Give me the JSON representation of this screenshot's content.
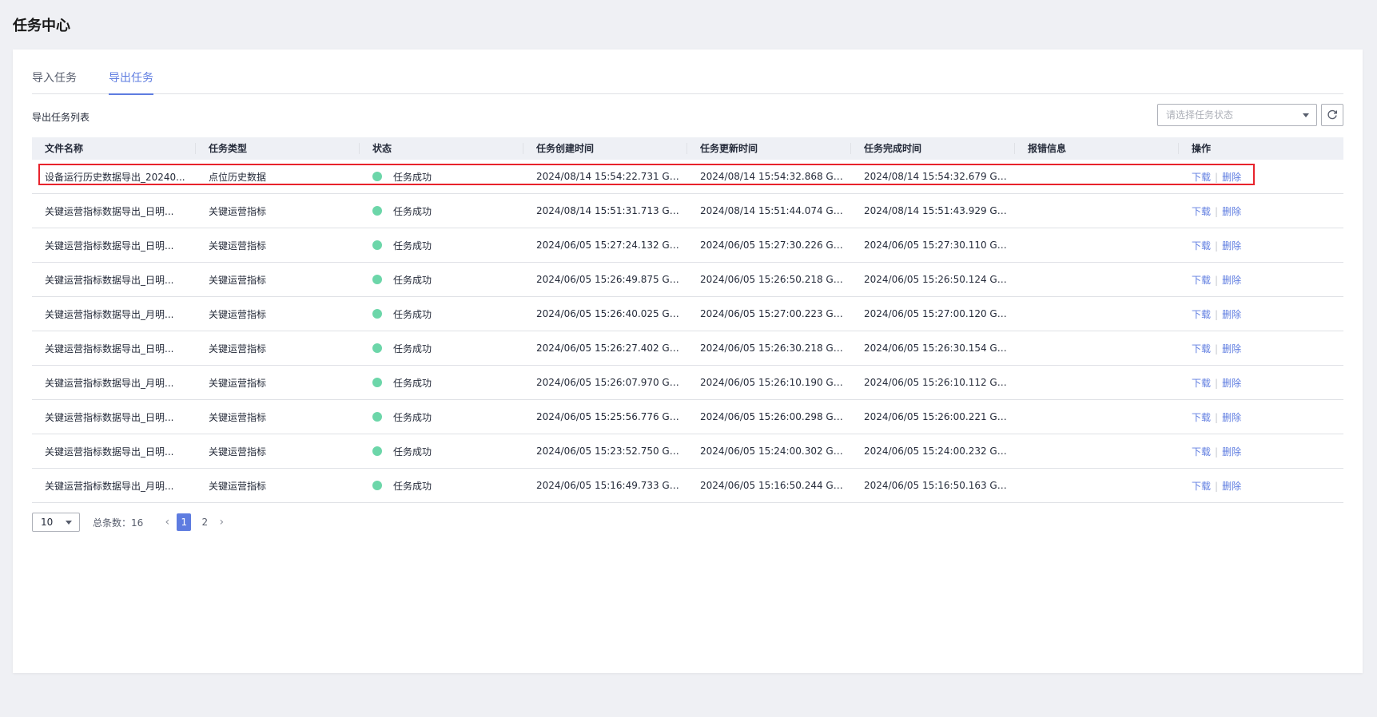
{
  "page_title": "任务中心",
  "tabs": [
    {
      "label": "导入任务",
      "active": false
    },
    {
      "label": "导出任务",
      "active": true
    }
  ],
  "list_title": "导出任务列表",
  "status_filter": {
    "placeholder": "请选择任务状态"
  },
  "refresh_icon": "refresh-icon",
  "columns": [
    "文件名称",
    "任务类型",
    "状态",
    "任务创建时间",
    "任务更新时间",
    "任务完成时间",
    "报错信息",
    "操作"
  ],
  "rows": [
    {
      "name": "设备运行历史数据导出_20240...",
      "type": "点位历史数据",
      "status": "任务成功",
      "created": "2024/08/14 15:54:22.731 GM...",
      "updated": "2024/08/14 15:54:32.868 GM...",
      "finished": "2024/08/14 15:54:32.679 GM...",
      "error": "",
      "download": "下载",
      "delete": "删除"
    },
    {
      "name": "关键运营指标数据导出_日明...",
      "type": "关键运营指标",
      "status": "任务成功",
      "created": "2024/08/14 15:51:31.713 GM...",
      "updated": "2024/08/14 15:51:44.074 GM...",
      "finished": "2024/08/14 15:51:43.929 GM...",
      "error": "",
      "download": "下载",
      "delete": "删除"
    },
    {
      "name": "关键运营指标数据导出_日明...",
      "type": "关键运营指标",
      "status": "任务成功",
      "created": "2024/06/05 15:27:24.132 GM...",
      "updated": "2024/06/05 15:27:30.226 GM...",
      "finished": "2024/06/05 15:27:30.110 GM...",
      "error": "",
      "download": "下载",
      "delete": "删除"
    },
    {
      "name": "关键运营指标数据导出_日明...",
      "type": "关键运营指标",
      "status": "任务成功",
      "created": "2024/06/05 15:26:49.875 GM...",
      "updated": "2024/06/05 15:26:50.218 GM...",
      "finished": "2024/06/05 15:26:50.124 GM...",
      "error": "",
      "download": "下载",
      "delete": "删除"
    },
    {
      "name": "关键运营指标数据导出_月明...",
      "type": "关键运营指标",
      "status": "任务成功",
      "created": "2024/06/05 15:26:40.025 GM...",
      "updated": "2024/06/05 15:27:00.223 GM...",
      "finished": "2024/06/05 15:27:00.120 GM...",
      "error": "",
      "download": "下载",
      "delete": "删除"
    },
    {
      "name": "关键运营指标数据导出_日明...",
      "type": "关键运营指标",
      "status": "任务成功",
      "created": "2024/06/05 15:26:27.402 GM...",
      "updated": "2024/06/05 15:26:30.218 GM...",
      "finished": "2024/06/05 15:26:30.154 GM...",
      "error": "",
      "download": "下载",
      "delete": "删除"
    },
    {
      "name": "关键运营指标数据导出_月明...",
      "type": "关键运营指标",
      "status": "任务成功",
      "created": "2024/06/05 15:26:07.970 GM...",
      "updated": "2024/06/05 15:26:10.190 GM...",
      "finished": "2024/06/05 15:26:10.112 GM...",
      "error": "",
      "download": "下载",
      "delete": "删除"
    },
    {
      "name": "关键运营指标数据导出_日明...",
      "type": "关键运营指标",
      "status": "任务成功",
      "created": "2024/06/05 15:25:56.776 GM...",
      "updated": "2024/06/05 15:26:00.298 GM...",
      "finished": "2024/06/05 15:26:00.221 GM...",
      "error": "",
      "download": "下载",
      "delete": "删除"
    },
    {
      "name": "关键运营指标数据导出_日明...",
      "type": "关键运营指标",
      "status": "任务成功",
      "created": "2024/06/05 15:23:52.750 GM...",
      "updated": "2024/06/05 15:24:00.302 GM...",
      "finished": "2024/06/05 15:24:00.232 GM...",
      "error": "",
      "download": "下载",
      "delete": "删除"
    },
    {
      "name": "关键运营指标数据导出_月明...",
      "type": "关键运营指标",
      "status": "任务成功",
      "created": "2024/06/05 15:16:49.733 GM...",
      "updated": "2024/06/05 15:16:50.244 GM...",
      "finished": "2024/06/05 15:16:50.163 GM...",
      "error": "",
      "download": "下载",
      "delete": "删除"
    }
  ],
  "colors": {
    "accent": "#5e7ce0",
    "success": "#6cd6a9",
    "highlight": "#e8232c"
  },
  "pagination": {
    "page_size": "10",
    "total_label": "总条数：16",
    "pages": [
      "1",
      "2"
    ],
    "current_page": "1",
    "prev_icon": "chevron-left-icon",
    "next_icon": "chevron-right-icon"
  }
}
